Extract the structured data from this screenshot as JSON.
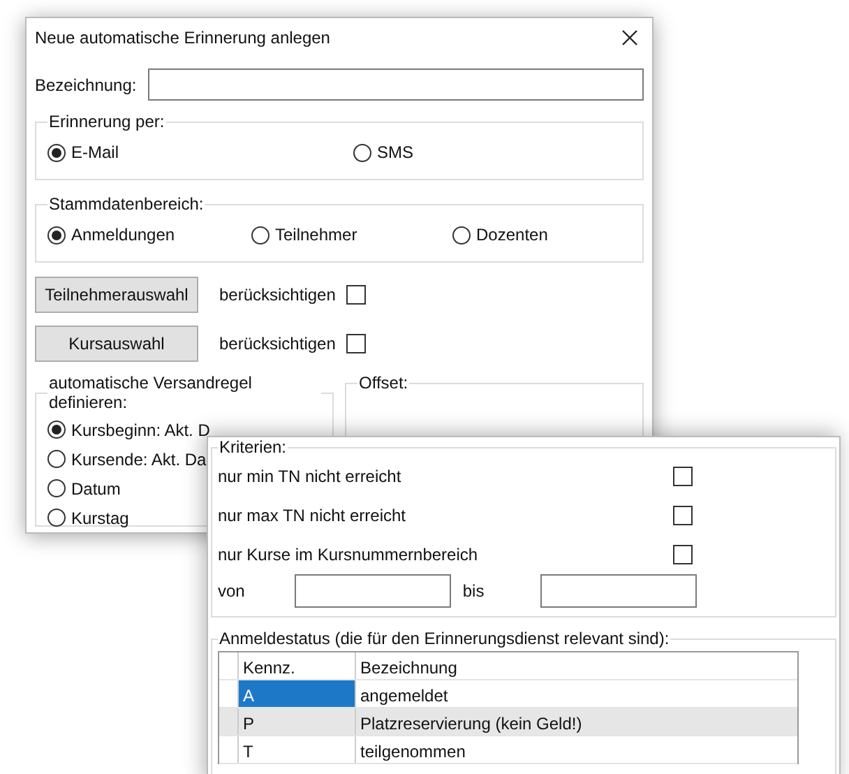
{
  "main_window": {
    "title": "Neue automatische Erinnerung anlegen",
    "name_field": {
      "label": "Bezeichnung:"
    },
    "reminder_via": {
      "legend": "Erinnerung per:",
      "options": [
        {
          "label": "E-Mail",
          "selected": true
        },
        {
          "label": "SMS",
          "selected": false
        }
      ]
    },
    "master_data": {
      "legend": "Stammdatenbereich:",
      "options": [
        {
          "label": "Anmeldungen",
          "selected": true
        },
        {
          "label": "Teilnehmer",
          "selected": false
        },
        {
          "label": "Dozenten",
          "selected": false
        }
      ]
    },
    "selections": [
      {
        "button": "Teilnehmerauswahl",
        "label": "berücksichtigen",
        "checked": false
      },
      {
        "button": "Kursauswahl",
        "label": "berücksichtigen",
        "checked": false
      }
    ],
    "dispatch_rule": {
      "legend": "automatische Versandregel definieren:",
      "options": [
        {
          "label": "Kursbeginn: Akt. D",
          "selected": true
        },
        {
          "label": "Kursende: Akt. Da",
          "selected": false
        },
        {
          "label": "Datum",
          "selected": false
        },
        {
          "label": "Kurstag",
          "selected": false
        }
      ]
    },
    "offset": {
      "legend": "Offset:"
    }
  },
  "criteria_window": {
    "criteria": {
      "legend": "Kriterien:",
      "items": [
        {
          "label": "nur min TN nicht erreicht",
          "checked": false
        },
        {
          "label": "nur max TN nicht erreicht",
          "checked": false
        },
        {
          "label": "nur Kurse im Kursnummernbereich",
          "checked": false
        }
      ],
      "range": {
        "from_label": "von",
        "to_label": "bis"
      }
    },
    "status": {
      "legend": "Anmeldestatus (die für den Erinnerungsdienst relevant sind):",
      "columns": [
        "Kennz.",
        "Bezeichnung"
      ],
      "rows": [
        {
          "code": "A",
          "name": "angemeldet",
          "selected": true,
          "highlighted": false
        },
        {
          "code": "P",
          "name": "Platzreservierung (kein Geld!)",
          "selected": false,
          "highlighted": true
        },
        {
          "code": "T",
          "name": "teilgenommen",
          "selected": false,
          "highlighted": false
        }
      ]
    }
  }
}
